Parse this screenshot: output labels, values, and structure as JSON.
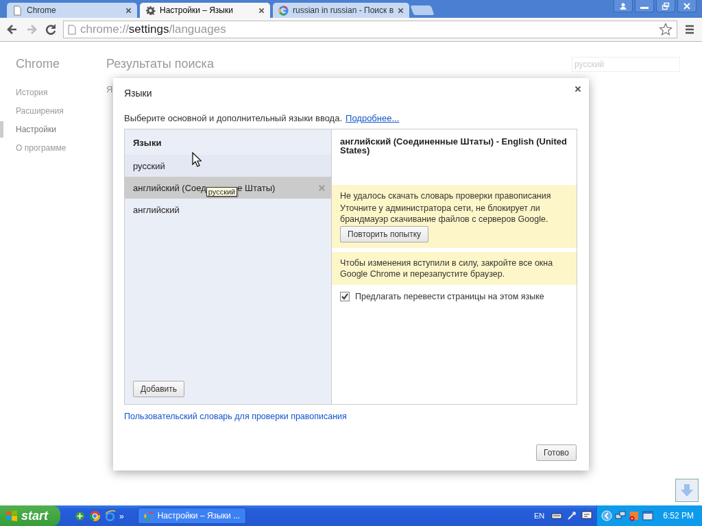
{
  "tabs": [
    {
      "kind": "page",
      "title": "Chrome",
      "selected": false
    },
    {
      "kind": "gear",
      "title": "Настройки – Языки",
      "selected": true
    },
    {
      "kind": "google",
      "title": "russian in russian - Поиск в",
      "selected": false
    }
  ],
  "address": {
    "scheme": "chrome://",
    "host": "settings",
    "path": "/languages"
  },
  "page": {
    "brand": "Chrome",
    "heading": "Результаты поиска",
    "peek": "Я",
    "search": {
      "value": "русский"
    },
    "nav": [
      {
        "label": "История",
        "selected": false
      },
      {
        "label": "Расширения",
        "selected": false
      },
      {
        "label": "Настройки",
        "selected": true
      },
      {
        "label": "О программе",
        "selected": false
      }
    ]
  },
  "dialog": {
    "title": "Языки",
    "description": "Выберите основной и дополнительный языки ввода.",
    "more_link": "Подробнее...",
    "list_header": "Языки",
    "languages": [
      {
        "label": "русский",
        "selected": false,
        "hovered": true
      },
      {
        "label": "английский (Соед",
        "label_after": "е Штаты)",
        "tooltip": "русский",
        "selected": true,
        "hovered": false
      },
      {
        "label": "английский",
        "selected": false,
        "hovered": false
      }
    ],
    "add_button": "Добавить",
    "detail": {
      "title": "английский (Соединенные Штаты) - English (United States)",
      "error_title": "Не удалось скачать словарь проверки правописания",
      "error_text": "Уточните у администратора сети, не блокирует ли брандмауэр скачивание файлов с серверов Google.",
      "retry_button": "Повторить попытку",
      "restart_note": "Чтобы изменения вступили в силу, закройте все окна Google Chrome и перезапустите браузер.",
      "offer_translate": {
        "label": "Предлагать перевести страницы на этом языке",
        "checked": true
      }
    },
    "dictionary_link": "Пользовательский словарь для проверки правописания",
    "done_button": "Готово"
  },
  "taskbar": {
    "start": "start",
    "quick_launch_more": "»",
    "task": "Настройки – Языки ...",
    "language": "EN",
    "clock": "6:52 PM"
  }
}
